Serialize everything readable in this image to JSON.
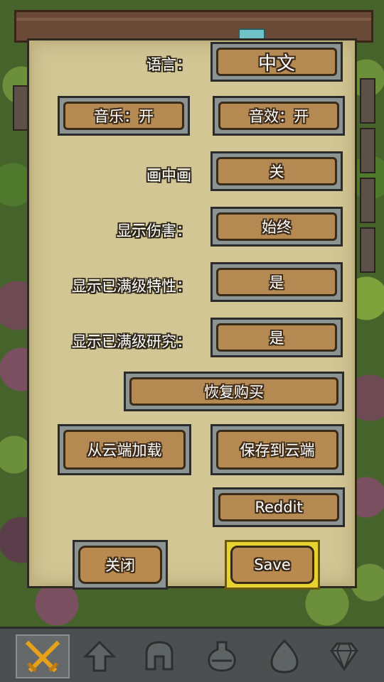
{
  "settings": {
    "language_label": "语言：",
    "language_value": "中文",
    "music_button": "音乐：开",
    "sfx_button": "音效：开",
    "pip_label": "画中画",
    "pip_value": "关",
    "show_damage_label": "显示伤害：",
    "show_damage_value": "始终",
    "show_maxed_traits_label": "显示已满级特性：",
    "show_maxed_traits_value": "是",
    "show_maxed_research_label": "显示已满级研究：",
    "show_maxed_research_value": "是",
    "restore_purchases_button": "恢复购买",
    "load_from_cloud_button": "从云端加载",
    "save_to_cloud_button": "保存到云端",
    "reddit_button": "Reddit",
    "close_button": "关闭",
    "save_button": "Save"
  },
  "tabbar": {
    "tabs": [
      {
        "icon": "crossed-swords-icon",
        "active": true
      },
      {
        "icon": "upgrade-arrow-icon",
        "active": false
      },
      {
        "icon": "helmet-icon",
        "active": false
      },
      {
        "icon": "potion-icon",
        "active": false
      },
      {
        "icon": "egg-icon",
        "active": false
      },
      {
        "icon": "gem-icon",
        "active": false
      }
    ]
  },
  "colors": {
    "parchment": "#d2c694",
    "button_wood": "#b48a52",
    "button_frame": "#8c9393",
    "highlight_frame": "#e6d231",
    "active_icon": "#e8a21a"
  }
}
